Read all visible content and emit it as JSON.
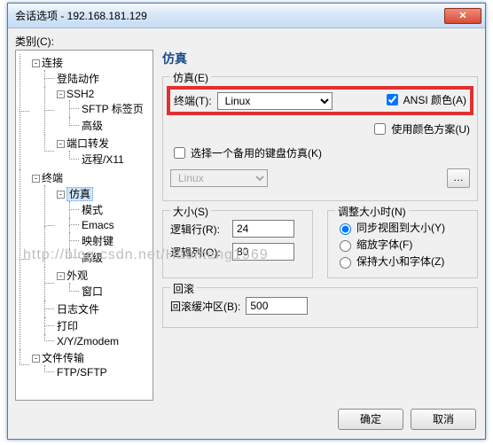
{
  "window": {
    "title": "会话选项 - 192.168.181.129"
  },
  "category_label": "类别(C):",
  "tree": {
    "connection": "连接",
    "login_actions": "登陆动作",
    "ssh2": "SSH2",
    "sftp_tab": "SFTP 标签页",
    "advanced1": "高级",
    "port_fwd": "端口转发",
    "remote_x11": "远程/X11",
    "terminal": "终端",
    "emulation": "仿真",
    "modes": "模式",
    "emacs": "Emacs",
    "map_keys": "映射键",
    "advanced2": "高级",
    "appearance": "外观",
    "window": "窗口",
    "logfile": "日志文件",
    "print": "打印",
    "xy_zmodem": "X/Y/Zmodem",
    "file_transfer": "文件传输",
    "ftp_sftp": "FTP/SFTP"
  },
  "pane_title": "仿真",
  "emu_group": {
    "legend": "仿真(E)",
    "terminal_label": "终端(T):",
    "terminal_value": "Linux",
    "ansi_color": "ANSI 颜色(A)",
    "use_color_scheme": "使用颜色方案(U)",
    "select_backup": "选择一个备用的键盘仿真(K)",
    "backup_value": "Linux"
  },
  "size_group": {
    "legend": "大小(S)",
    "rows_label": "逻辑行(R):",
    "rows_value": "24",
    "cols_label": "逻辑列(O):",
    "cols_value": "80",
    "resize_legend": "调整大小时(N)",
    "sync_view": "同步视图到大小(Y)",
    "scale_font": "缩放字体(F)",
    "keep_size_font": "保持大小和字体(Z)"
  },
  "scroll_group": {
    "legend": "回滚",
    "buffer_label": "回滚缓冲区(B):",
    "buffer_value": "500"
  },
  "buttons": {
    "ok": "确定",
    "cancel": "取消"
  },
  "watermark": "http://blog.csdn.net/Haomeng1569"
}
